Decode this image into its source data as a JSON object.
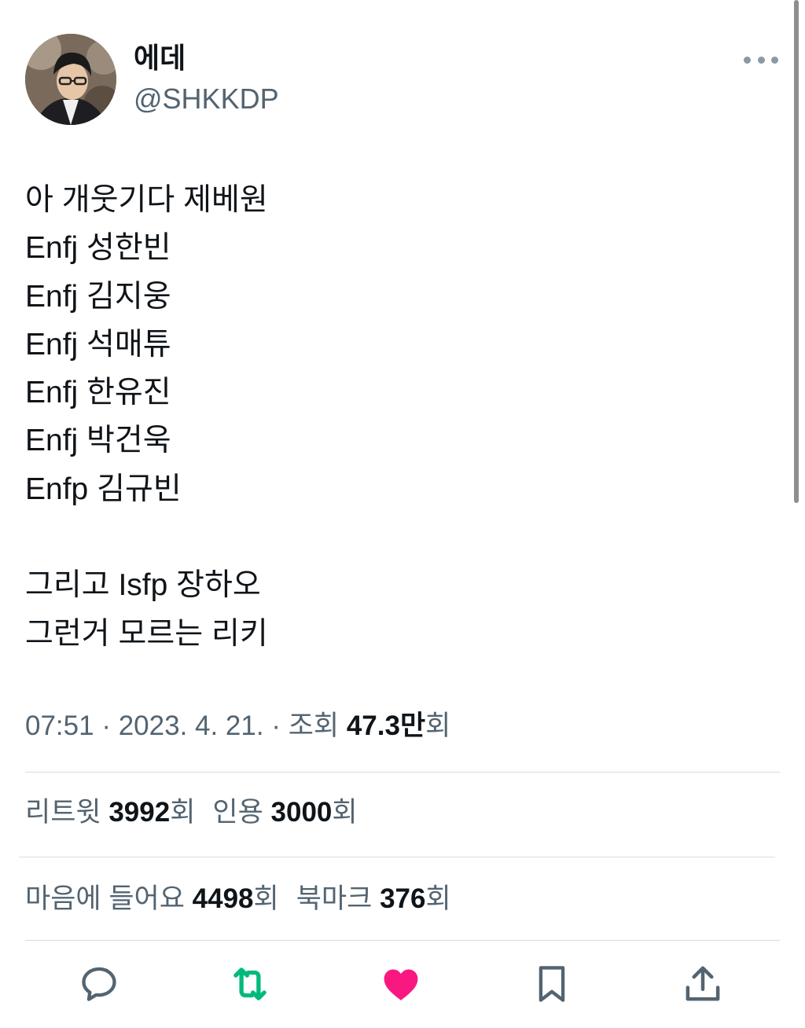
{
  "author": {
    "display_name": "에데",
    "handle": "@SHKKDP",
    "avatar_icon": "profile-photo"
  },
  "tweet": {
    "lines": [
      "아 개웃기다 제베원",
      "Enfj 성한빈",
      "Enfj 김지웅",
      "Enfj 석매튜",
      "Enfj 한유진",
      "Enfj 박건욱",
      "Enfp 김규빈",
      "",
      "그리고 Isfp 장하오",
      "그런거 모르는 리키"
    ]
  },
  "meta": {
    "time": "07:51",
    "sep1": " · ",
    "date": "2023. 4. 21.",
    "sep2": " · ",
    "views_label": "조회 ",
    "views_count": "47.3만",
    "views_suffix": "회"
  },
  "stats": {
    "retweets_label": "리트윗 ",
    "retweets_count": "3992",
    "retweets_suffix": "회",
    "quotes_label": "인용 ",
    "quotes_count": "3000",
    "quotes_suffix": "회",
    "likes_label": "마음에 들어요 ",
    "likes_count": "4498",
    "likes_suffix": "회",
    "bookmarks_label": "북마크 ",
    "bookmarks_count": "376",
    "bookmarks_suffix": "회"
  },
  "actions": {
    "reply_icon": "reply-icon",
    "retweet_icon": "retweet-icon",
    "like_icon": "like-icon",
    "bookmark_icon": "bookmark-icon",
    "share_icon": "share-icon"
  },
  "colors": {
    "text": "#0f1419",
    "secondary": "#536471",
    "retweet_active": "#00ba7c",
    "like_active": "#f91880",
    "divider": "#d9dde1"
  }
}
